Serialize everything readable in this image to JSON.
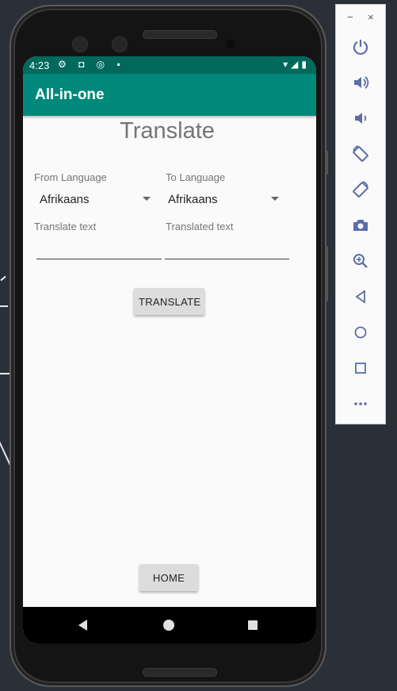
{
  "status_bar": {
    "time": "4:23",
    "left_icons": "⚙ ◘ ◎ ▪",
    "right_icons": "▾◢▮"
  },
  "app_bar": {
    "title": "All-in-one"
  },
  "main": {
    "title": "Translate",
    "from_language_label": "From Language",
    "from_language_value": "Afrikaans",
    "to_language_label": "To Language",
    "to_language_value": "Afrikaans",
    "translate_text_label": "Translate text",
    "translated_text_label": "Translated text",
    "translate_button": "TRANSLATE",
    "home_button": "HOME"
  },
  "emulator_toolbar": {
    "minimize": "−",
    "close": "×",
    "icons": [
      "power-icon",
      "volume-up-icon",
      "volume-down-icon",
      "rotate-left-icon",
      "rotate-right-icon",
      "camera-icon",
      "zoom-icon",
      "back-icon",
      "home-icon",
      "overview-icon",
      "more-icon"
    ]
  },
  "colors": {
    "app_bar": "#00897b",
    "status_bar": "#00695c",
    "toolbar_icon": "#5b6ea8"
  }
}
